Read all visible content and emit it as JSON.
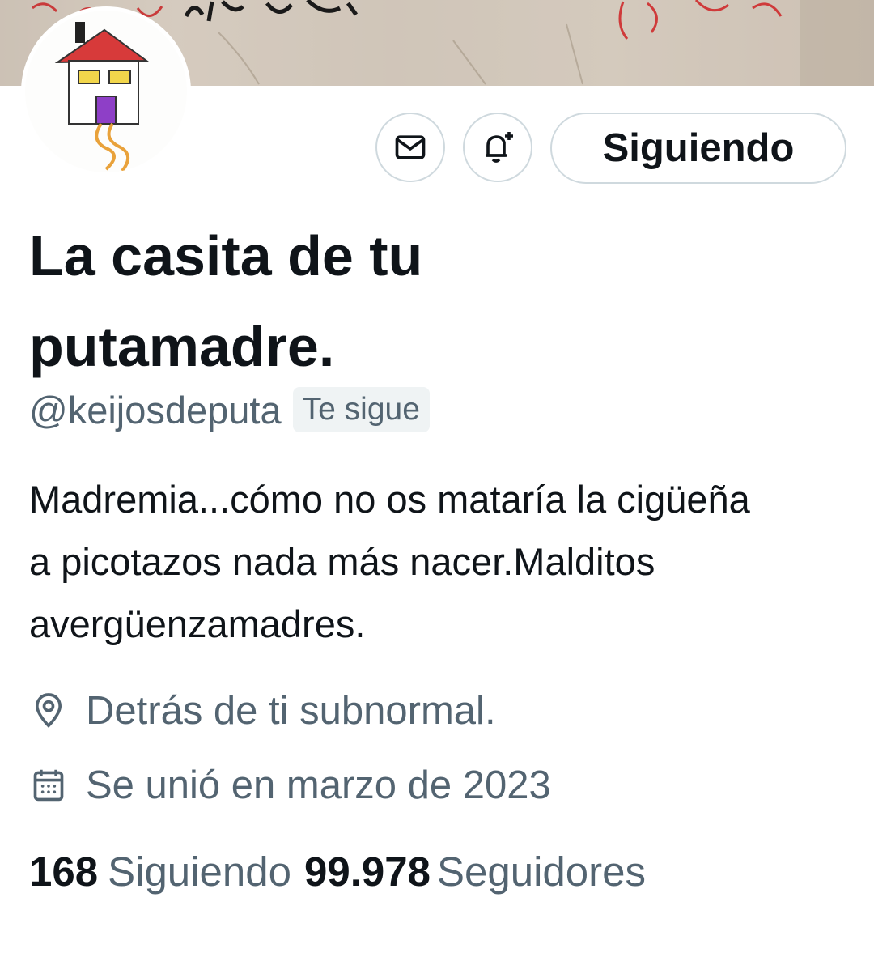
{
  "profile": {
    "display_name": "La casita de tu putamadre.",
    "handle": "@keijosdeputa",
    "follows_you_badge": "Te sigue",
    "bio": "Madremia...cómo no os mataría la cigüeña a picotazos nada más nacer.Malditos avergüenzamadres.",
    "location": "Detrás de ti subnormal.",
    "joined": "Se unió en marzo de 2023"
  },
  "actions": {
    "message_icon": "envelope-icon",
    "notify_icon": "bell-plus-icon",
    "follow_label": "Siguiendo"
  },
  "stats": {
    "following_count": "168",
    "following_label": "Siguiendo",
    "followers_count": "99.978",
    "followers_label": "Seguidores"
  },
  "icons": {
    "location": "location-pin-icon",
    "calendar": "calendar-icon"
  },
  "colors": {
    "text_primary": "#0f1419",
    "text_secondary": "#536471",
    "border": "#cfd9de",
    "badge_bg": "#eff3f4"
  }
}
